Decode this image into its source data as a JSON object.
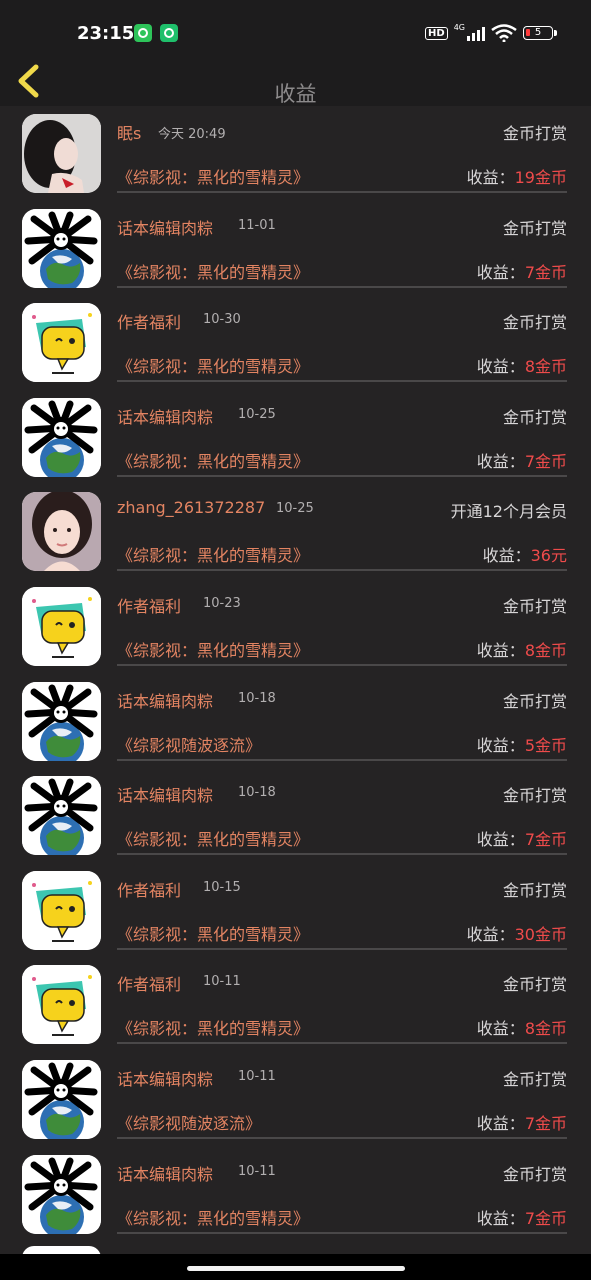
{
  "status_bar": {
    "time": "23:15",
    "network": "4G",
    "hd": "HD",
    "battery": "5"
  },
  "header": {
    "title": "收益"
  },
  "colors": {
    "accent_name": "#e38462",
    "earn_value": "#ef4b4b",
    "back_arrow": "#f0d94a"
  },
  "rows": [
    {
      "name": "眠s",
      "date": "今天 20:49",
      "type": "金币打赏",
      "book": "《综影视：黑化的雪精灵》",
      "earn_label": "收益：",
      "earn_value": "19金币",
      "avatar": "girl-photo-avatar"
    },
    {
      "name": "话本编辑肉粽",
      "date": "11-01",
      "type": "金币打赏",
      "book": "《综影视：黑化的雪精灵》",
      "earn_label": "收益：",
      "earn_value": "7金币",
      "avatar": "earth-meme-avatar"
    },
    {
      "name": "作者福利",
      "date": "10-30",
      "type": "金币打赏",
      "book": "《综影视：黑化的雪精灵》",
      "earn_label": "收益：",
      "earn_value": "8金币",
      "avatar": "chat-bubble-avatar"
    },
    {
      "name": "话本编辑肉粽",
      "date": "10-25",
      "type": "金币打赏",
      "book": "《综影视：黑化的雪精灵》",
      "earn_label": "收益：",
      "earn_value": "7金币",
      "avatar": "earth-meme-avatar"
    },
    {
      "name": "zhang_261372287",
      "date": "10-25",
      "type": "开通12个月会员",
      "book": "《综影视：黑化的雪精灵》",
      "earn_label": "收益：",
      "earn_value": "36元",
      "avatar": "woman-photo-avatar"
    },
    {
      "name": "作者福利",
      "date": "10-23",
      "type": "金币打赏",
      "book": "《综影视：黑化的雪精灵》",
      "earn_label": "收益：",
      "earn_value": "8金币",
      "avatar": "chat-bubble-avatar"
    },
    {
      "name": "话本编辑肉粽",
      "date": "10-18",
      "type": "金币打赏",
      "book": "《综影视随波逐流》",
      "earn_label": "收益：",
      "earn_value": "5金币",
      "avatar": "earth-meme-avatar"
    },
    {
      "name": "话本编辑肉粽",
      "date": "10-18",
      "type": "金币打赏",
      "book": "《综影视：黑化的雪精灵》",
      "earn_label": "收益：",
      "earn_value": "7金币",
      "avatar": "earth-meme-avatar"
    },
    {
      "name": "作者福利",
      "date": "10-15",
      "type": "金币打赏",
      "book": "《综影视：黑化的雪精灵》",
      "earn_label": "收益：",
      "earn_value": "30金币",
      "avatar": "chat-bubble-avatar"
    },
    {
      "name": "作者福利",
      "date": "10-11",
      "type": "金币打赏",
      "book": "《综影视：黑化的雪精灵》",
      "earn_label": "收益：",
      "earn_value": "8金币",
      "avatar": "chat-bubble-avatar"
    },
    {
      "name": "话本编辑肉粽",
      "date": "10-11",
      "type": "金币打赏",
      "book": "《综影视随波逐流》",
      "earn_label": "收益：",
      "earn_value": "7金币",
      "avatar": "earth-meme-avatar"
    },
    {
      "name": "话本编辑肉粽",
      "date": "10-11",
      "type": "金币打赏",
      "book": "《综影视：黑化的雪精灵》",
      "earn_label": "收益：",
      "earn_value": "7金币",
      "avatar": "earth-meme-avatar"
    }
  ]
}
